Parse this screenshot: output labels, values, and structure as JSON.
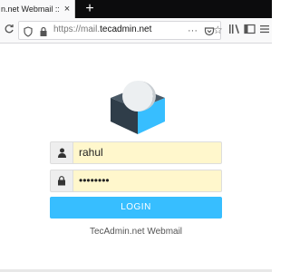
{
  "browser": {
    "tab_title": "n.net Webmail :: Welc",
    "tab_close": "×",
    "new_tab": "+",
    "url_scheme": "https://mail.",
    "url_host": "tecadmin.net"
  },
  "login": {
    "username": "rahul",
    "password": "••••••••",
    "button_label": "LOGIN",
    "footer": "TecAdmin.net Webmail"
  },
  "colors": {
    "accent": "#37beff",
    "input_bg": "#fff7cc",
    "logo_dark": "#2f3d49"
  }
}
